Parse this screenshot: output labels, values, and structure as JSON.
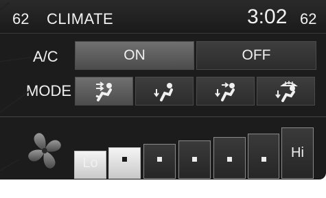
{
  "header": {
    "temp_left": "62",
    "title": "CLIMATE",
    "clock": "3:02",
    "temp_right": "62"
  },
  "ac": {
    "label": "A/C",
    "options": [
      "ON",
      "OFF"
    ],
    "selected": "ON"
  },
  "mode": {
    "label": "MODE",
    "options": [
      "face-vent-icon",
      "floor-vent-icon",
      "face-floor-vent-icon",
      "floor-defrost-vent-icon"
    ],
    "selected_index": 0
  },
  "fan": {
    "levels": [
      "Lo",
      "",
      "",
      "",
      "",
      "",
      "Hi"
    ],
    "current_level": 2,
    "icon": "fan-icon"
  },
  "colors": {
    "panel": "#1c1c1c",
    "selected": "#707070",
    "active_bar": "#f4f4f4"
  }
}
